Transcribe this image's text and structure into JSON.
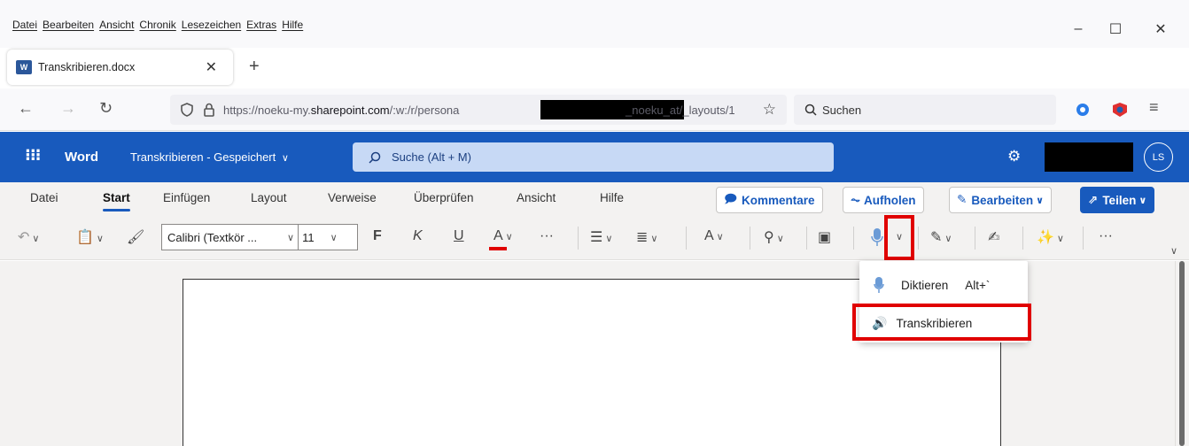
{
  "browser": {
    "menu": [
      "Datei",
      "Bearbeiten",
      "Ansicht",
      "Chronik",
      "Lesezeichen",
      "Extras",
      "Hilfe"
    ],
    "window_controls": {
      "minimize": "–",
      "maximize": "☐",
      "close": "✕"
    },
    "tab": {
      "badge": "W",
      "title": "Transkribieren.docx",
      "close": "✕"
    },
    "new_tab": "+",
    "nav": {
      "back": "←",
      "forward": "→",
      "reload": "↻"
    },
    "url": {
      "prefix": "https://noeku-my.",
      "host": "sharepoint.com",
      "path": "/:w:/r/persona",
      "suffix": "_noeku_at/_layouts/1"
    },
    "bookmark_star": "☆",
    "search": {
      "icon": "🔍",
      "placeholder": "Suchen"
    }
  },
  "word_header": {
    "app_name": "Word",
    "doc_title": "Transkribieren - Gespeichert",
    "search_placeholder": "Suche (Alt + M)",
    "avatar": "LS"
  },
  "ribbon": {
    "tabs": [
      "Datei",
      "Start",
      "Einfügen",
      "Layout",
      "Verweise",
      "Überprüfen",
      "Ansicht",
      "Hilfe"
    ],
    "active_tab": "Start",
    "actions": {
      "comments": "Kommentare",
      "catchup": "Aufholen",
      "editing": "Bearbeiten",
      "share": "Teilen"
    }
  },
  "toolbar": {
    "font_name": "Calibri (Textkör ...",
    "font_size": "11",
    "bold": "F",
    "italic": "K",
    "underline": "U",
    "font_color": "A",
    "more": "···"
  },
  "dictate_menu": {
    "items": [
      {
        "label": "Diktieren",
        "shortcut": "Alt+`"
      },
      {
        "label": "Transkribieren",
        "shortcut": ""
      }
    ]
  },
  "colors": {
    "accent": "#185abd",
    "highlight": "#e00000"
  }
}
